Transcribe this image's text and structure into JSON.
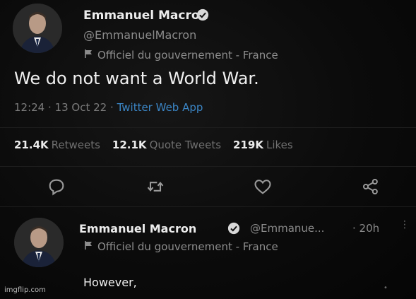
{
  "main_tweet": {
    "author_name": "Emmanuel Macron",
    "handle": "@EmmanuelMacron",
    "gov_label": "Officiel du gouvernement - France",
    "text": "We do not want a World War.",
    "time": "12:24",
    "date": "13 Oct 22",
    "separator": "·",
    "app": "Twitter Web App",
    "stats": {
      "retweets_count": "21.4K",
      "retweets_label": "Retweets",
      "quote_count": "12.1K",
      "quote_label": "Quote Tweets",
      "likes_count": "219K",
      "likes_label": "Likes"
    }
  },
  "reply_tweet": {
    "author_name": "Emmanuel Macron",
    "handle": "@Emmanue...",
    "age": "· 20h",
    "gov_label": "Officiel du gouvernement - France",
    "text": "However,"
  },
  "watermark": "imgflip.com",
  "colors": {
    "background": "#050505",
    "link_blue": "#3b86c6",
    "muted": "#8a8a8a"
  }
}
